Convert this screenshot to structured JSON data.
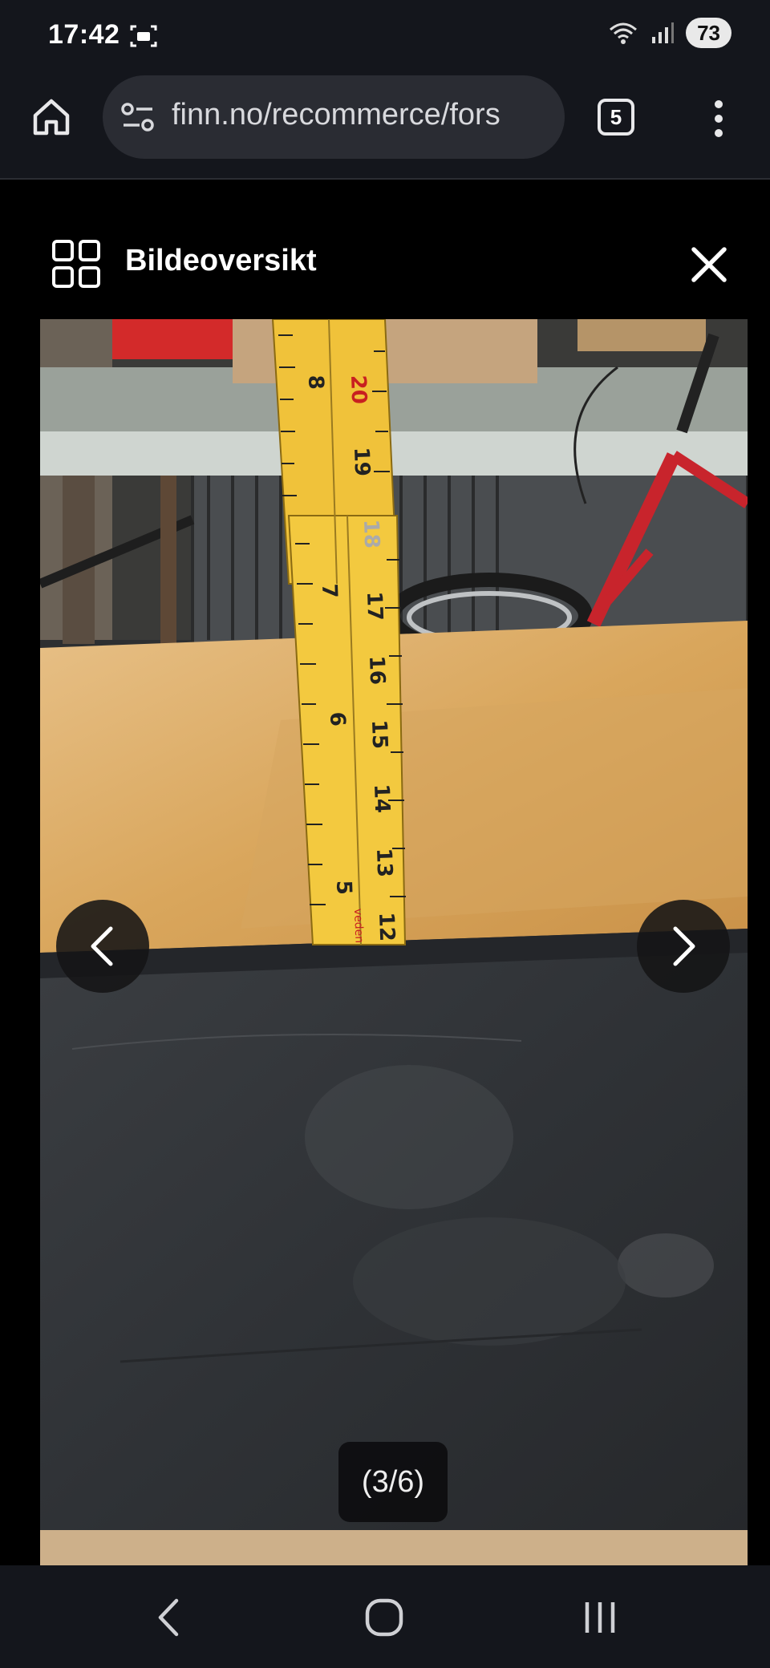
{
  "status_bar": {
    "time": "17:42",
    "battery": "73",
    "icons": [
      "screenshot-icon",
      "wifi-icon",
      "signal-icon",
      "battery-icon"
    ]
  },
  "browser": {
    "url": "finn.no/recommerce/fors",
    "tab_count": "5",
    "icons": [
      "home-icon",
      "site-settings-icon",
      "tab-switcher-icon",
      "more-vert-icon"
    ]
  },
  "gallery": {
    "title": "Bildeoversikt",
    "counter": "(3/6)",
    "icons": [
      "grid-icon",
      "close-icon",
      "chevron-left-icon",
      "chevron-right-icon"
    ]
  },
  "photo": {
    "ruler_numbers_left": [
      "8",
      "7",
      "6",
      "5"
    ],
    "ruler_numbers_right_upper": [
      "20",
      "19"
    ],
    "ruler_numbers_right_lower": [
      "18",
      "17",
      "16",
      "15",
      "14",
      "13",
      "12"
    ],
    "ruler_brand": "veden"
  },
  "system_nav": {
    "icons": [
      "back-icon",
      "home-circle-icon",
      "recents-icon"
    ]
  },
  "colors": {
    "ruler_yellow": "#f0c23a",
    "board_black": "#2f3236",
    "table_wood": "#d9a65c",
    "bike_red": "#c8242c"
  }
}
